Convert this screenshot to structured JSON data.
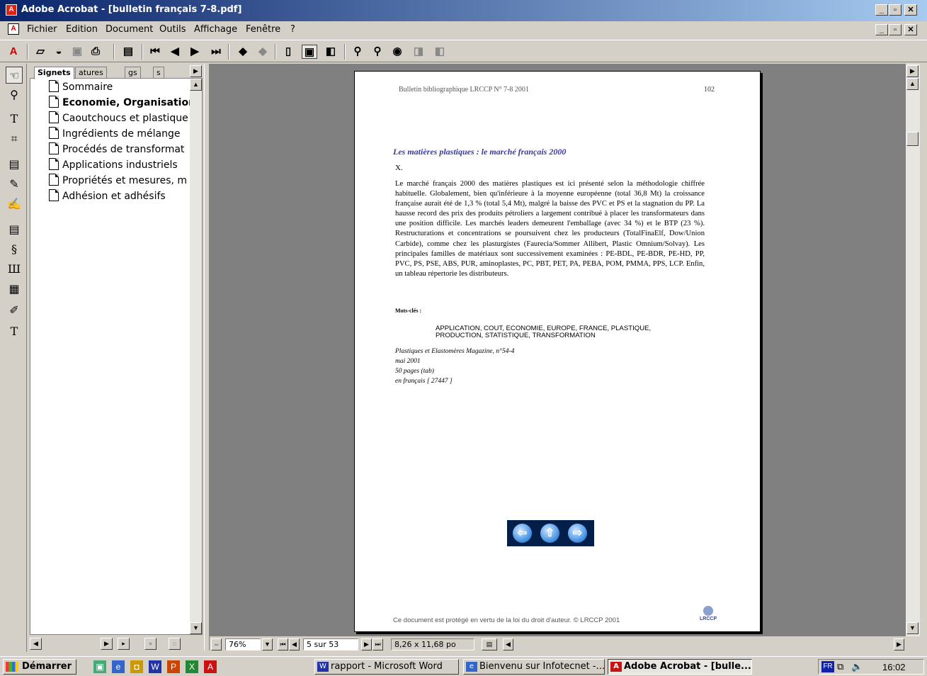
{
  "window": {
    "title": "Adobe Acrobat - [bulletin français 7-8.pdf]",
    "controls": [
      "_",
      "🗗",
      "✕"
    ]
  },
  "menu": [
    "Fichier",
    "Edition",
    "Document",
    "Outils",
    "Affichage",
    "Fenêtre",
    "?"
  ],
  "toolbar_icons": [
    "acrobat-logo-icon",
    "open-icon",
    "open-web-icon",
    "save-icon",
    "print-icon",
    "show-pane-icon",
    "first-page-icon",
    "prev-page-icon",
    "next-page-icon",
    "last-page-icon",
    "go-back-icon",
    "go-forward-icon",
    "actual-size-icon",
    "fit-page-icon",
    "fit-width-icon",
    "find-icon",
    "search-icon",
    "search-results-icon",
    "prev-highlight-icon",
    "next-highlight-icon"
  ],
  "tools": [
    "hand-icon",
    "zoom-icon",
    "text-select-icon",
    "crop-icon",
    "note-icon",
    "pencil-icon",
    "highlight-icon",
    "movie-icon",
    "link-icon",
    "article-icon",
    "form-icon",
    "signature-icon",
    "touchup-text-icon"
  ],
  "navpane": {
    "tabs": [
      "Signets",
      "atures",
      "gs",
      "s"
    ],
    "bookmarks": [
      {
        "label": "Sommaire",
        "bold": false
      },
      {
        "label": "Economie, Organisation,",
        "bold": true
      },
      {
        "label": "Caoutchoucs et plastique",
        "bold": false
      },
      {
        "label": "Ingrédients de mélange",
        "bold": false
      },
      {
        "label": "Procédés de transformat",
        "bold": false
      },
      {
        "label": "Applications industriels",
        "bold": false
      },
      {
        "label": "Propriétés et mesures, m",
        "bold": false
      },
      {
        "label": "Adhésion et adhésifs",
        "bold": false
      }
    ]
  },
  "document": {
    "header_left": "Bulletin bibliographique LRCCP N° 7-8 2001",
    "header_right": "102",
    "title": "Les matières plastiques : le marché français 2000",
    "author": "X.",
    "body": "Le marché français 2000 des matières plastiques est ici présenté selon la méthodologie chiffrée habituelle. Globalement, bien qu'inférieure à la moyenne européenne (total 36,8 Mt) la croissance française aurait été de 1,3 % (total 5,4 Mt), malgré la baisse des PVC et PS et la stagnation du PP. La hausse record des prix des produits pétroliers a largement contribué à placer les transformateurs dans une position difficile. Les marchés leaders demeurent l'emballage (avec 34 %) et le BTP (23 %). Restructurations et concentrations se poursuivent chez les producteurs (TotalFinaElf, Dow/Union Carbide), comme chez les plasturgistes (Faurecia/Sommer Allibert, Plastic Omnium/Solvay). Les principales familles de matériaux sont successivement examinées : PE-BDL, PE-BDR, PE-HD, PP, PVC, PS, PSE, ABS, PUR, aminoplastes, PC, PBT, PET, PA, PEBA, POM, PMMA, PPS, LCP. Enfin, un tableau répertorie les distributeurs.",
    "keywords_label": "Mots-clés :",
    "keywords": "APPLICATION, COUT, ECONOMIE, EUROPE, FRANCE, PLASTIQUE, PRODUCTION, STATISTIQUE, TRANSFORMATION",
    "source": "Plastiques et Elastomères Magazine, n°54-4",
    "date": "mai 2001",
    "pages": "50 pages (tab)",
    "language": "en français [ 27447 ]",
    "footer": "Ce document est protégé en vertu de la loi du droit d'auteur. © LRCCP 2001",
    "logo_text": "LRCCP"
  },
  "status": {
    "zoom": "76%",
    "page": "5 sur 53",
    "size": "8,26 x 11,68 po"
  },
  "taskbar": {
    "start": "Démarrer",
    "tasks": [
      {
        "label": "rapport - Microsoft Word",
        "active": false
      },
      {
        "label": "Bienvenu sur Infotecnet -...",
        "active": false
      },
      {
        "label": "Adobe Acrobat - [bulle...",
        "active": true
      }
    ],
    "lang": "FR",
    "clock": "16:02"
  }
}
